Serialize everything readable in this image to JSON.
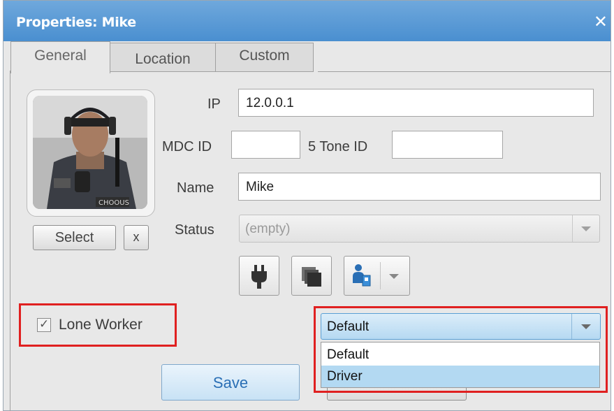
{
  "window": {
    "title": "Properties: Mike",
    "close_glyph": "✕"
  },
  "tabs": [
    {
      "label": "General",
      "active": true
    },
    {
      "label": "Location",
      "active": false
    },
    {
      "label": "Custom",
      "active": false
    }
  ],
  "form": {
    "ip_label": "IP",
    "ip_value": "12.0.0.1",
    "mdc_label": "MDC ID",
    "mdc_value": "",
    "tone_label": "5 Tone ID",
    "tone_value": "",
    "name_label": "Name",
    "name_value": "Mike",
    "status_label": "Status",
    "status_value": "(empty)"
  },
  "photo": {
    "select_label": "Select",
    "clear_label": "x",
    "badge_text": "CHOOUS"
  },
  "icons": {
    "plug": "plug-icon",
    "copy": "copy-icon",
    "person_radio": "person-radio-icon"
  },
  "lone_worker": {
    "label": "Lone Worker",
    "checked": true,
    "check_glyph": "✓"
  },
  "role_dropdown": {
    "selected": "Default",
    "options": [
      {
        "label": "Default",
        "highlighted": false
      },
      {
        "label": "Driver",
        "highlighted": true
      }
    ]
  },
  "buttons": {
    "save_label": "Save"
  },
  "colors": {
    "title_bar": "#4a8fd0",
    "highlight_box": "#e02020",
    "selection": "#b3d9f2"
  }
}
